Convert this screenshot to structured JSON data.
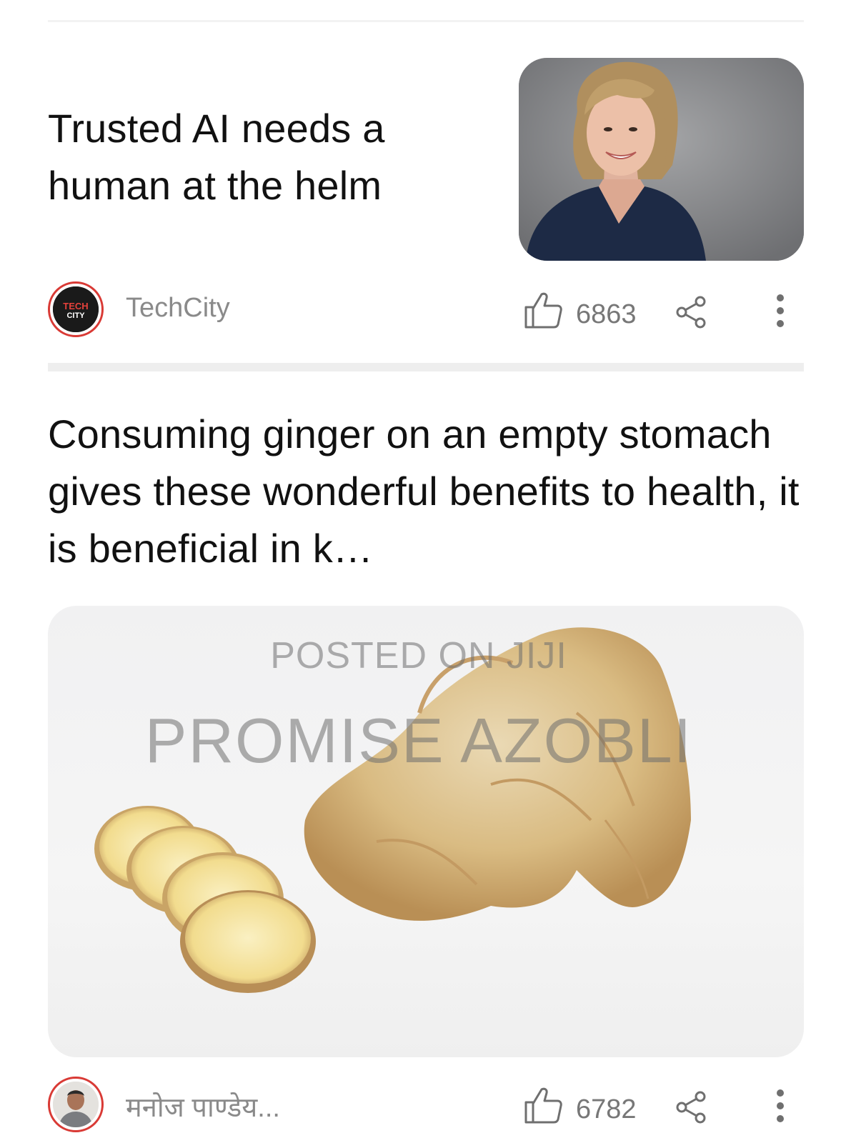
{
  "feed": {
    "articles": [
      {
        "title": "Trusted AI needs a human at the helm",
        "source": "TechCity",
        "source_logo_text": [
          "TECH",
          "CITY"
        ],
        "likes": "6863"
      },
      {
        "title": "Consuming ginger on an empty stomach gives these wonderful benefits to health, it is beneficial in k…",
        "image_watermark": [
          "POSTED ON JIJI",
          "PROMISE AZOBLI"
        ],
        "source": "मनोज पाण्डेय...",
        "likes": "6782"
      }
    ]
  },
  "icons": {
    "like": "thumbs-up-icon",
    "share": "share-icon",
    "more": "more-vertical-icon"
  },
  "colors": {
    "avatar_ring": "#d93a35",
    "meta_text": "#8a8a8a",
    "title_text": "#111111",
    "divider": "#eeeeee"
  }
}
